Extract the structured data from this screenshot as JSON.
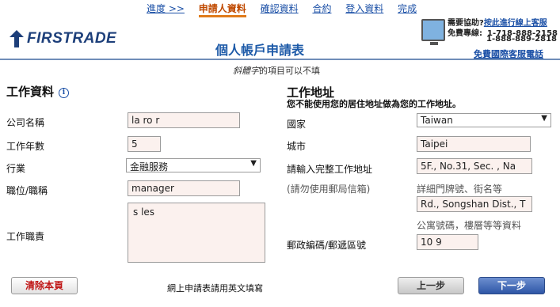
{
  "steps": {
    "progress": "進度 >>",
    "applicant": "申請人資料",
    "confirm": "確認資料",
    "contract": "合約",
    "login": "登入資料",
    "done": "完成"
  },
  "logo": {
    "text": "FIRSTRADE"
  },
  "page_title": "個人帳戶申請表",
  "help": {
    "question": "需要協助?",
    "live_chat": "按此進行線上客服",
    "hotline_label": "免費專線:",
    "phone1": "1-718-888-2158",
    "phone2": "1-888-889-2818",
    "intl_link": "免費國際客服電話"
  },
  "note": {
    "italic": "斜體字",
    "rest": "的項目可以不填"
  },
  "work_info": {
    "title": "工作資料",
    "company_label": "公司名稱",
    "company_value": "la    ro   r",
    "years_label": "工作年數",
    "years_value": "5",
    "industry_label": "行業",
    "industry_value": "金融服務",
    "position_label": "職位/職稱",
    "position_value": "manager",
    "duties_label": "工作職責",
    "duties_value": "s  les"
  },
  "work_address": {
    "title": "工作地址",
    "subtitle": "您不能使用您的居住地址做為您的工作地址。",
    "country_label": "國家",
    "country_value": "Taiwan",
    "city_label": "城市",
    "city_value": "Taipei",
    "address_label": "請輸入完整工作地址",
    "address_hint": "(請勿使用郵局信箱)",
    "address1_value": "5F., No.31, Sec. , Na",
    "address1_hint": "詳細門牌號、街名等",
    "address2_value": "Rd., Songshan Dist., T",
    "address2_hint": "公寓號碼，樓層等等資料",
    "postal_label": "郵政編碼/郵遞區號",
    "postal_value": "10  9"
  },
  "buttons": {
    "clear": "清除本頁",
    "prev": "上一步",
    "next": "下一步"
  },
  "footer_note": "網上申請表請用英文填寫"
}
